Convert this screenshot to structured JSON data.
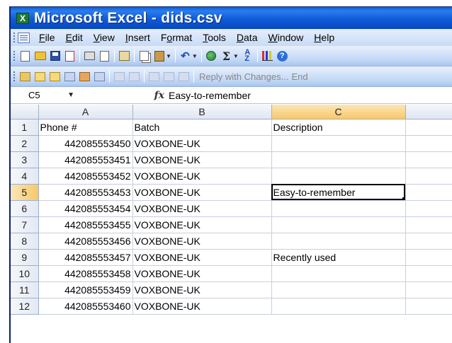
{
  "window": {
    "title": "Microsoft Excel - dids.csv"
  },
  "menu": {
    "items": [
      "File",
      "Edit",
      "View",
      "Insert",
      "Format",
      "Tools",
      "Data",
      "Window",
      "Help"
    ]
  },
  "toolbar": {
    "sum_symbol": "Σ",
    "help_symbol": "?",
    "reply_with_changes": "Reply with Changes...",
    "end_review": "End"
  },
  "formula_bar": {
    "name_box": "C5",
    "fx_label": "fx",
    "value": "Easy-to-remember"
  },
  "sheet": {
    "columns": [
      "A",
      "B",
      "C"
    ],
    "rows": [
      {
        "num": "1",
        "a": "Phone #",
        "b": "Batch",
        "c": "Description"
      },
      {
        "num": "2",
        "a": "442085553450",
        "b": "VOXBONE-UK",
        "c": ""
      },
      {
        "num": "3",
        "a": "442085553451",
        "b": "VOXBONE-UK",
        "c": ""
      },
      {
        "num": "4",
        "a": "442085553452",
        "b": "VOXBONE-UK",
        "c": ""
      },
      {
        "num": "5",
        "a": "442085553453",
        "b": "VOXBONE-UK",
        "c": "Easy-to-remember"
      },
      {
        "num": "6",
        "a": "442085553454",
        "b": "VOXBONE-UK",
        "c": ""
      },
      {
        "num": "7",
        "a": "442085553455",
        "b": "VOXBONE-UK",
        "c": ""
      },
      {
        "num": "8",
        "a": "442085553456",
        "b": "VOXBONE-UK",
        "c": ""
      },
      {
        "num": "9",
        "a": "442085553457",
        "b": "VOXBONE-UK",
        "c": "Recently used"
      },
      {
        "num": "10",
        "a": "442085553458",
        "b": "VOXBONE-UK",
        "c": ""
      },
      {
        "num": "11",
        "a": "442085553459",
        "b": "VOXBONE-UK",
        "c": ""
      },
      {
        "num": "12",
        "a": "442085553460",
        "b": "VOXBONE-UK",
        "c": ""
      }
    ],
    "active_cell": "C5"
  }
}
